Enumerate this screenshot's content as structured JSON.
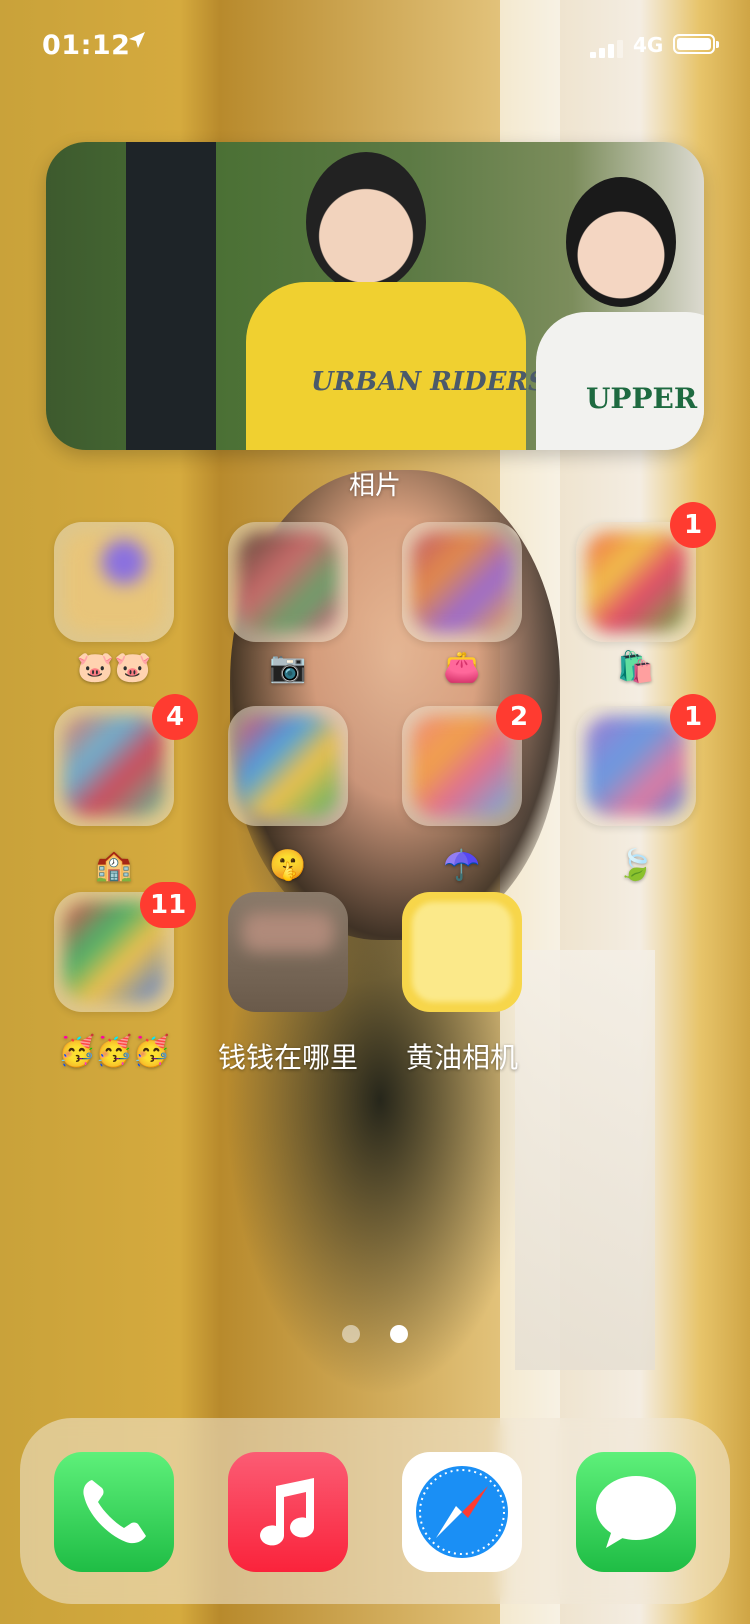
{
  "status_bar": {
    "time": "01:12",
    "location_icon": "location-arrow-icon",
    "network": "4G",
    "signal_bars": 3,
    "battery_level": 0.9
  },
  "widget": {
    "label": "相片",
    "shirt_text_1": "URBAN RIDERS",
    "shirt_text_2": "UPPER"
  },
  "folders": [
    {
      "label": "🐷🐷",
      "badge": ""
    },
    {
      "label": "📷",
      "badge": ""
    },
    {
      "label": "👛",
      "badge": ""
    },
    {
      "label": "🛍️",
      "badge": "1"
    },
    {
      "label": "🏫",
      "badge": "4"
    },
    {
      "label": "🤫",
      "badge": ""
    },
    {
      "label": "☂️",
      "badge": "2"
    },
    {
      "label": "🍃",
      "badge": "1"
    },
    {
      "label": "🥳🥳🥳",
      "badge": "11"
    }
  ],
  "apps": [
    {
      "label": "钱钱在哪里",
      "icon": "money-app-icon"
    },
    {
      "label": "黄油相机",
      "icon": "butter-camera-icon"
    }
  ],
  "page_dots": {
    "count": 2,
    "active_index": 1
  },
  "dock": [
    {
      "name": "phone",
      "icon": "phone-icon",
      "color": "#33c759"
    },
    {
      "name": "music",
      "icon": "music-note-icon",
      "color": "#fc3c5b"
    },
    {
      "name": "safari",
      "icon": "compass-icon",
      "color": "#1a8ff5"
    },
    {
      "name": "messages",
      "icon": "speech-bubble-icon",
      "color": "#33c759"
    }
  ]
}
